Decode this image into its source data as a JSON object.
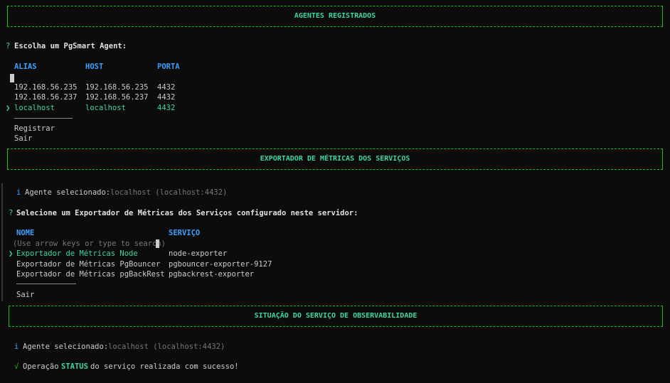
{
  "sections": [
    {
      "title": "AGENTES REGISTRADOS"
    },
    {
      "title": "EXPORTADOR DE MÉTRICAS DOS SERVIÇOS"
    },
    {
      "title": "SITUAÇÃO DO SERVIÇO DE OBSERVABILIDADE"
    }
  ],
  "agent_prompt": {
    "mark": "?",
    "question": "Escolha um PgSmart Agent:",
    "columns": [
      "ALIAS",
      "HOST",
      "PORTA"
    ],
    "rows": [
      {
        "alias": "192.168.56.235",
        "host": "192.168.56.235",
        "port": "4432",
        "selected": false
      },
      {
        "alias": "192.168.56.237",
        "host": "192.168.56.237",
        "port": "4432",
        "selected": false
      },
      {
        "alias": "localhost",
        "host": "localhost",
        "port": "4432",
        "selected": true
      }
    ],
    "pointer": "❯",
    "extra_options": [
      "Registrar",
      "Sair"
    ]
  },
  "exporter_info": {
    "icon": "i",
    "label": "Agente selecionado:",
    "value": "localhost (localhost:4432)"
  },
  "exporter_prompt": {
    "mark": "?",
    "question": "Selecione um Exportador de Métricas dos Serviços configurado neste servidor:",
    "columns": [
      "NOME",
      "SERVIÇO"
    ],
    "hint": "(Use arrow keys or type to search)",
    "pointer": "❯",
    "rows": [
      {
        "name": "Exportador de Métricas Node",
        "service": "node-exporter",
        "selected": true
      },
      {
        "name": "Exportador de Métricas PgBouncer",
        "service": "pgbouncer-exporter-9127",
        "selected": false
      },
      {
        "name": "Exportador de Métricas pgBackRest",
        "service": "pgbackrest-exporter",
        "selected": false
      }
    ],
    "extra_options": [
      "Sair"
    ]
  },
  "status_info": {
    "icon": "i",
    "label": "Agente selecionado:",
    "value": "localhost (localhost:4432)"
  },
  "status_result": {
    "icon": "√",
    "prefix": "Operação",
    "keyword": "STATUS",
    "suffix": "do serviço realizada com sucesso!"
  }
}
